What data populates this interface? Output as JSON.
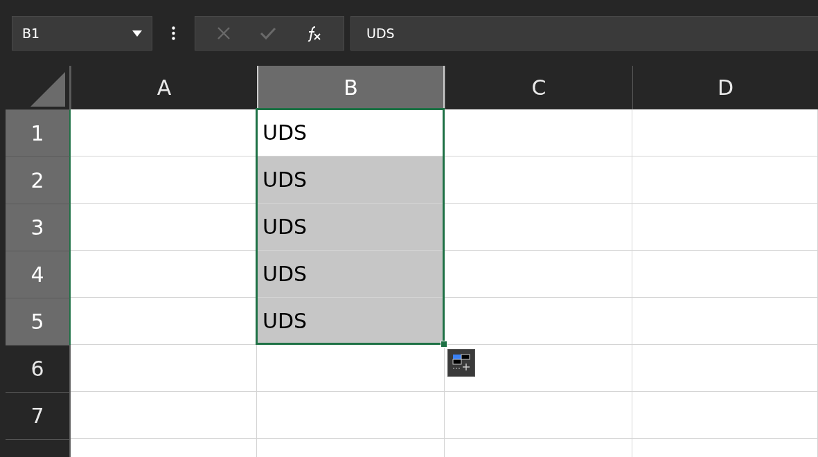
{
  "name_box": {
    "value": "B1"
  },
  "formula_bar": {
    "value": "UDS"
  },
  "columns": [
    {
      "label": "A",
      "selected": false
    },
    {
      "label": "B",
      "selected": true
    },
    {
      "label": "C",
      "selected": false
    },
    {
      "label": "D",
      "selected": false
    }
  ],
  "rows": [
    {
      "label": "1",
      "selected": true,
      "cells": [
        {
          "selected": false
        },
        {
          "text": "UDS",
          "selected": true,
          "active": true
        },
        {
          "selected": false
        },
        {
          "selected": false
        }
      ]
    },
    {
      "label": "2",
      "selected": true,
      "cells": [
        {
          "selected": false
        },
        {
          "text": "UDS",
          "selected": true,
          "active": false
        },
        {
          "selected": false
        },
        {
          "selected": false
        }
      ]
    },
    {
      "label": "3",
      "selected": true,
      "cells": [
        {
          "selected": false
        },
        {
          "text": "UDS",
          "selected": true,
          "active": false
        },
        {
          "selected": false
        },
        {
          "selected": false
        }
      ]
    },
    {
      "label": "4",
      "selected": true,
      "cells": [
        {
          "selected": false
        },
        {
          "text": "UDS",
          "selected": true,
          "active": false
        },
        {
          "selected": false
        },
        {
          "selected": false
        }
      ]
    },
    {
      "label": "5",
      "selected": true,
      "cells": [
        {
          "selected": false
        },
        {
          "text": "UDS",
          "selected": true,
          "active": false
        },
        {
          "selected": false
        },
        {
          "selected": false
        }
      ]
    },
    {
      "label": "6",
      "selected": false,
      "cells": [
        {
          "selected": false
        },
        {
          "selected": false
        },
        {
          "selected": false
        },
        {
          "selected": false
        }
      ]
    },
    {
      "label": "7",
      "selected": false,
      "cells": [
        {
          "selected": false
        },
        {
          "selected": false
        },
        {
          "selected": false
        },
        {
          "selected": false
        }
      ]
    }
  ]
}
